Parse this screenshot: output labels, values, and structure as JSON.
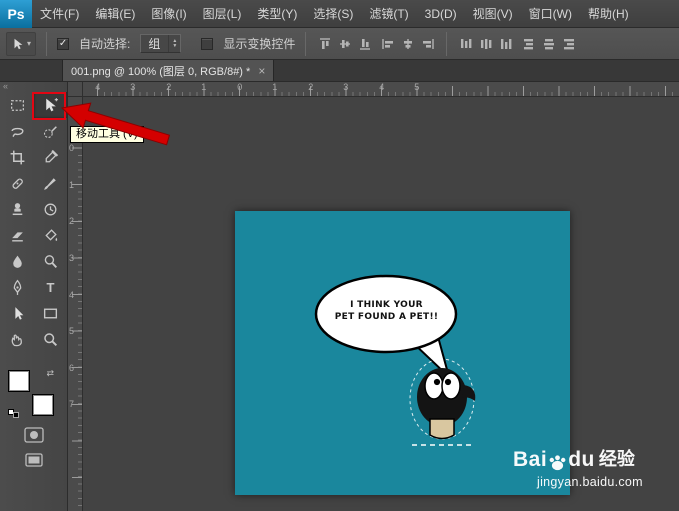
{
  "app": {
    "logo": "Ps"
  },
  "menubar": {
    "items": [
      "文件(F)",
      "编辑(E)",
      "图像(I)",
      "图层(L)",
      "类型(Y)",
      "选择(S)",
      "滤镜(T)",
      "3D(D)",
      "视图(V)",
      "窗口(W)",
      "帮助(H)"
    ]
  },
  "options": {
    "auto_select_label": "自动选择:",
    "auto_select_value": "组",
    "show_transform_label": "显示变换控件"
  },
  "tabbar": {
    "title": "001.png @ 100% (图层 0, RGB/8#) *",
    "close": "×"
  },
  "toolpanel": {
    "collapse_glyph": "«",
    "type_tool_glyph": "T",
    "swap_glyph": "⇄"
  },
  "glyphs": {
    "check": "✓",
    "dropdown": "▾",
    "up": "▲",
    "down": "▼"
  },
  "tooltip": {
    "text": "移动工具 (V)"
  },
  "rulers": {
    "horizontal": [
      "4",
      "3",
      "2",
      "1",
      "0",
      "1",
      "2",
      "3",
      "4",
      "5"
    ],
    "vertical": [
      "0",
      "1",
      "2",
      "3",
      "4",
      "5",
      "6",
      "7"
    ]
  },
  "canvas": {
    "speech_line1": "I THINK YOUR",
    "speech_line2": "PET FOUND A PET!!",
    "image_bg": "#1a879d"
  },
  "watermark": {
    "brand_part1": "Bai",
    "brand_part2": "du",
    "brand_suffix": "经验",
    "url": "jingyan.baidu.com"
  },
  "colors": {
    "annotation_red": "#e30613",
    "tooltip_bg": "#ffffe1",
    "image_teal": "#1a879d",
    "ui_dark": "#434343"
  }
}
